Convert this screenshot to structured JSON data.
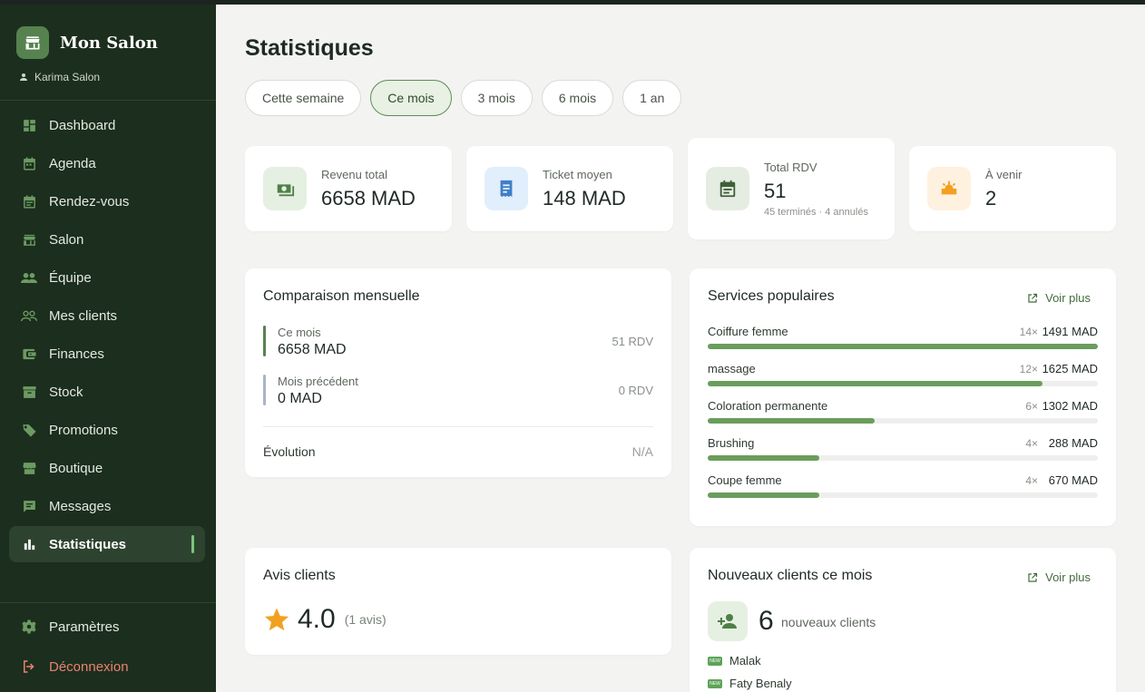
{
  "app": {
    "title": "Mon Salon",
    "user": "Karima Salon"
  },
  "sidebar": {
    "items": [
      {
        "label": "Dashboard",
        "icon": "dashboard-icon"
      },
      {
        "label": "Agenda",
        "icon": "calendar-icon"
      },
      {
        "label": "Rendez-vous",
        "icon": "event-icon"
      },
      {
        "label": "Salon",
        "icon": "store-icon"
      },
      {
        "label": "Équipe",
        "icon": "team-icon"
      },
      {
        "label": "Mes clients",
        "icon": "clients-icon"
      },
      {
        "label": "Finances",
        "icon": "wallet-icon"
      },
      {
        "label": "Stock",
        "icon": "inventory-icon"
      },
      {
        "label": "Promotions",
        "icon": "tag-icon"
      },
      {
        "label": "Boutique",
        "icon": "shop-icon"
      },
      {
        "label": "Messages",
        "icon": "message-icon"
      },
      {
        "label": "Statistiques",
        "icon": "bar-chart-icon",
        "active": true
      }
    ],
    "bottom": [
      {
        "label": "Paramètres",
        "icon": "gear-icon"
      },
      {
        "label": "Déconnexion",
        "icon": "logout-icon"
      }
    ]
  },
  "page": {
    "title": "Statistiques",
    "filters": [
      "Cette semaine",
      "Ce mois",
      "3 mois",
      "6 mois",
      "1 an"
    ],
    "active_filter": "Ce mois"
  },
  "kpis": [
    {
      "label": "Revenu total",
      "value": "6658 MAD",
      "icon": "money-icon"
    },
    {
      "label": "Ticket moyen",
      "value": "148 MAD",
      "icon": "receipt-icon"
    },
    {
      "label": "Total RDV",
      "value": "51",
      "sub": "45 terminés · 4 annulés",
      "icon": "calendar-icon"
    },
    {
      "label": "À venir",
      "value": "2",
      "icon": "sunrise-icon"
    }
  ],
  "comparison": {
    "title": "Comparaison mensuelle",
    "current": {
      "label": "Ce mois",
      "value": "6658 MAD",
      "rdv": "51 RDV"
    },
    "previous": {
      "label": "Mois précédent",
      "value": "0 MAD",
      "rdv": "0 RDV"
    },
    "evolution_label": "Évolution",
    "evolution_value": "N/A"
  },
  "services": {
    "title": "Services populaires",
    "voir_plus": "Voir plus",
    "items": [
      {
        "name": "Coiffure femme",
        "count": "14×",
        "amount": "1491 MAD",
        "share": 1.0
      },
      {
        "name": "massage",
        "count": "12×",
        "amount": "1625 MAD",
        "share": 0.857
      },
      {
        "name": "Coloration permanente",
        "count": "6×",
        "amount": "1302 MAD",
        "share": 0.429
      },
      {
        "name": "Brushing",
        "count": "4×",
        "amount": "288 MAD",
        "share": 0.286
      },
      {
        "name": "Coupe femme",
        "count": "4×",
        "amount": "670 MAD",
        "share": 0.286
      }
    ]
  },
  "reviews": {
    "title": "Avis clients",
    "rating": "4.0",
    "count": "(1 avis)"
  },
  "new_clients": {
    "title": "Nouveaux clients ce mois",
    "voir_plus": "Voir plus",
    "count": "6",
    "count_label": "nouveaux clients",
    "badge": "NEW",
    "clients": [
      "Malak",
      "Faty Benaly"
    ]
  },
  "colors": {
    "sidebar_bg": "#1c2e1d",
    "accent": "#6a9d5c",
    "logout": "#e98272"
  }
}
